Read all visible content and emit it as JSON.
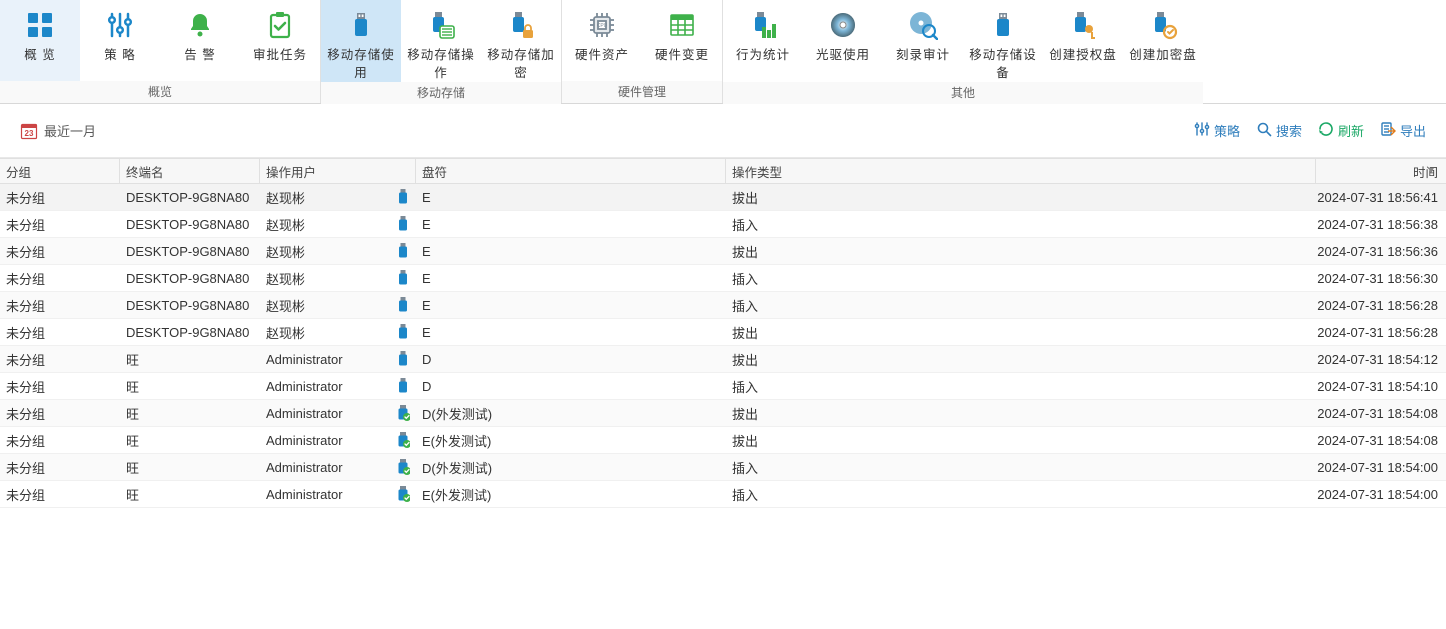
{
  "ribbon": {
    "groups": [
      {
        "title": "概览",
        "items": [
          {
            "id": "overview",
            "label": "概  览",
            "icon": "grid",
            "active": false
          },
          {
            "id": "policy",
            "label": "策  略",
            "icon": "sliders",
            "active": false
          },
          {
            "id": "alert",
            "label": "告  警",
            "icon": "bell",
            "active": false
          },
          {
            "id": "approval",
            "label": "审批任务",
            "icon": "clipboard",
            "active": false
          }
        ]
      },
      {
        "title": "移动存储",
        "items": [
          {
            "id": "usb-usage",
            "label": "移动存储使用",
            "icon": "usb",
            "active": true
          },
          {
            "id": "usb-op",
            "label": "移动存储操作",
            "icon": "usb-list",
            "active": false
          },
          {
            "id": "usb-encrypt",
            "label": "移动存储加密",
            "icon": "usb-lock",
            "active": false
          }
        ]
      },
      {
        "title": "硬件管理",
        "items": [
          {
            "id": "hw-asset",
            "label": "硬件资产",
            "icon": "cpu",
            "active": false
          },
          {
            "id": "hw-change",
            "label": "硬件变更",
            "icon": "table",
            "active": false
          }
        ]
      },
      {
        "title": "其他",
        "items": [
          {
            "id": "behavior",
            "label": "行为统计",
            "icon": "usb-chart",
            "active": false
          },
          {
            "id": "optical",
            "label": "光驱使用",
            "icon": "disc",
            "active": false
          },
          {
            "id": "burn-audit",
            "label": "刻录审计",
            "icon": "disc-audit",
            "active": false
          },
          {
            "id": "usb-device",
            "label": "移动存储设备",
            "icon": "usb",
            "active": false
          },
          {
            "id": "create-auth",
            "label": "创建授权盘",
            "icon": "usb-key",
            "active": false
          },
          {
            "id": "create-enc",
            "label": "创建加密盘",
            "icon": "usb-enc",
            "active": false
          }
        ]
      }
    ]
  },
  "filterbar": {
    "date_label": "最近一月",
    "date_number": "23",
    "actions": {
      "policy": "策略",
      "search": "搜索",
      "refresh": "刷新",
      "export": "导出"
    }
  },
  "table": {
    "columns": [
      "分组",
      "终端名",
      "操作用户",
      "盘符",
      "操作类型",
      "时间"
    ],
    "sort_col": 5,
    "rows": [
      {
        "group": "未分组",
        "host": "DESKTOP-9G8NA80",
        "user": "赵现彬",
        "drive": "E",
        "kind": "plain",
        "op": "拔出",
        "time": "2024-07-31 18:56:41",
        "sel": true
      },
      {
        "group": "未分组",
        "host": "DESKTOP-9G8NA80",
        "user": "赵现彬",
        "drive": "E",
        "kind": "plain",
        "op": "插入",
        "time": "2024-07-31 18:56:38",
        "sel": false
      },
      {
        "group": "未分组",
        "host": "DESKTOP-9G8NA80",
        "user": "赵现彬",
        "drive": "E",
        "kind": "plain",
        "op": "拔出",
        "time": "2024-07-31 18:56:36",
        "sel": false
      },
      {
        "group": "未分组",
        "host": "DESKTOP-9G8NA80",
        "user": "赵现彬",
        "drive": "E",
        "kind": "plain",
        "op": "插入",
        "time": "2024-07-31 18:56:30",
        "sel": false
      },
      {
        "group": "未分组",
        "host": "DESKTOP-9G8NA80",
        "user": "赵现彬",
        "drive": "E",
        "kind": "plain",
        "op": "插入",
        "time": "2024-07-31 18:56:28",
        "sel": false
      },
      {
        "group": "未分组",
        "host": "DESKTOP-9G8NA80",
        "user": "赵现彬",
        "drive": "E",
        "kind": "plain",
        "op": "拔出",
        "time": "2024-07-31 18:56:28",
        "sel": false
      },
      {
        "group": "未分组",
        "host": "旺",
        "user": "Administrator",
        "drive": "D",
        "kind": "plain",
        "op": "拔出",
        "time": "2024-07-31 18:54:12",
        "sel": false
      },
      {
        "group": "未分组",
        "host": "旺",
        "user": "Administrator",
        "drive": "D",
        "kind": "plain",
        "op": "插入",
        "time": "2024-07-31 18:54:10",
        "sel": false
      },
      {
        "group": "未分组",
        "host": "旺",
        "user": "Administrator",
        "drive": "D(外发测试)",
        "kind": "check",
        "op": "拔出",
        "time": "2024-07-31 18:54:08",
        "sel": false
      },
      {
        "group": "未分组",
        "host": "旺",
        "user": "Administrator",
        "drive": "E(外发测试)",
        "kind": "check",
        "op": "拔出",
        "time": "2024-07-31 18:54:08",
        "sel": false
      },
      {
        "group": "未分组",
        "host": "旺",
        "user": "Administrator",
        "drive": "D(外发测试)",
        "kind": "check",
        "op": "插入",
        "time": "2024-07-31 18:54:00",
        "sel": false
      },
      {
        "group": "未分组",
        "host": "旺",
        "user": "Administrator",
        "drive": "E(外发测试)",
        "kind": "check",
        "op": "插入",
        "time": "2024-07-31 18:54:00",
        "sel": false
      }
    ]
  }
}
